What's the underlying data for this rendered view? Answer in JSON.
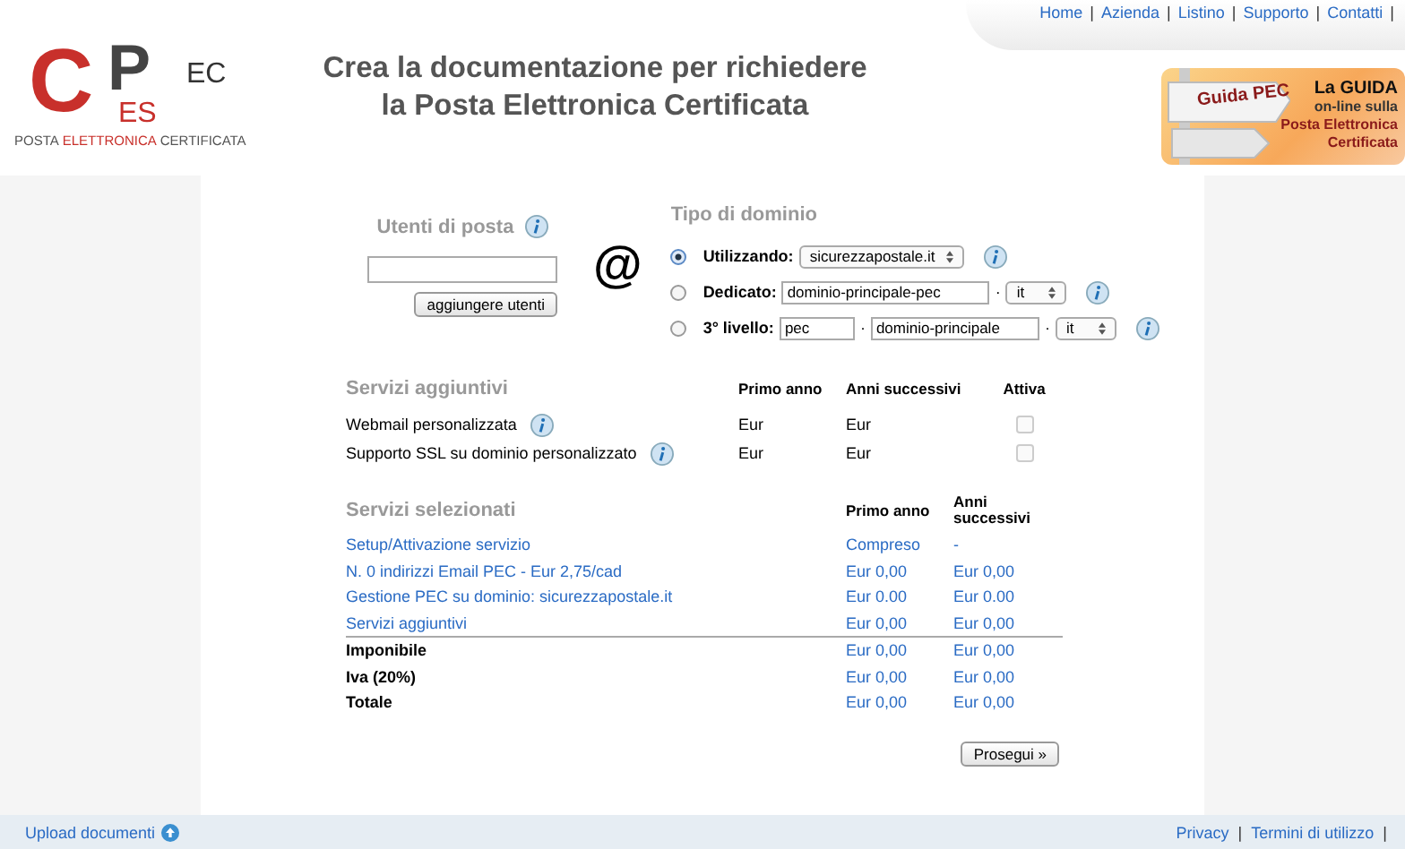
{
  "logo": {
    "big_c": "C",
    "big_p": "P",
    "es": "ES",
    "ec": "EC",
    "tagline": [
      "POSTA",
      "ELETTRONICA",
      "CERTIFICATA"
    ]
  },
  "headline": [
    "Crea la documentazione per richiedere",
    "la Posta Elettronica Certificata"
  ],
  "nav": [
    {
      "label": "Home",
      "sep": "|"
    },
    {
      "label": "Azienda",
      "sep": "|"
    },
    {
      "label": "Listino",
      "sep": "|"
    },
    {
      "label": "Supporto",
      "sep": "|"
    },
    {
      "label": "Contatti",
      "sep": "|"
    }
  ],
  "banner": {
    "sign": "Guida PEC",
    "line_1": "La GUIDA",
    "line_2": "on-line sulla",
    "line_3": "Posta Elettronica",
    "line_4": "Certificata"
  },
  "users": {
    "title": "Utenti di posta",
    "button": "aggiungere utenti",
    "at": "@"
  },
  "domain": {
    "title": "Tipo di dominio",
    "options": [
      {
        "label": "Utilizzando:",
        "selected": true,
        "fields": [
          {
            "kind": "select",
            "value": "sicurezzapostale.it"
          }
        ]
      },
      {
        "label": "Dedicato:",
        "selected": false,
        "fields": [
          {
            "kind": "input",
            "value": "dominio-principale-pec"
          },
          {
            "kind": "dot",
            "value": "·"
          },
          {
            "kind": "select",
            "value": "it"
          }
        ]
      },
      {
        "label": "3° livello:",
        "selected": false,
        "fields": [
          {
            "kind": "input",
            "value": "pec"
          },
          {
            "kind": "dot",
            "value": "·"
          },
          {
            "kind": "input",
            "value": "dominio-principale"
          },
          {
            "kind": "dot",
            "value": "·"
          },
          {
            "kind": "select",
            "value": "it"
          }
        ]
      }
    ]
  },
  "extras": {
    "title": "Servizi aggiuntivi",
    "columns": [
      "Primo anno",
      "Anni successivi",
      "Attiva"
    ],
    "rows": [
      {
        "label": "Webmail personalizzata",
        "first": "Eur",
        "next": "Eur",
        "checked": false
      },
      {
        "label": "Supporto SSL su dominio personalizzato",
        "first": "Eur",
        "next": "Eur",
        "checked": false
      }
    ]
  },
  "selected": {
    "title": "Servizi selezionati",
    "columns": [
      "Primo anno",
      "Anni successivi"
    ],
    "rows": [
      {
        "kind": "item",
        "label": "Setup/Attivazione servizio",
        "first": "Compreso",
        "next": "-"
      },
      {
        "kind": "item",
        "label": "N. 0 indirizzi Email PEC - Eur 2,75/cad",
        "first": "Eur 0,00",
        "next": "Eur 0,00"
      },
      {
        "kind": "item",
        "label": "Gestione PEC su dominio: sicurezzapostale.it",
        "first": "Eur 0.00",
        "next": "Eur 0.00"
      },
      {
        "kind": "item",
        "label": "Servizi aggiuntivi",
        "first": "Eur 0,00",
        "next": "Eur 0,00"
      },
      {
        "kind": "total",
        "label": "Imponibile",
        "first": "Eur 0,00",
        "next": "Eur 0,00"
      },
      {
        "kind": "total",
        "label": "Iva (20%)",
        "first": "Eur 0,00",
        "next": "Eur 0,00"
      },
      {
        "kind": "total",
        "label": "Totale",
        "first": "Eur 0,00",
        "next": "Eur 0,00"
      }
    ]
  },
  "continue_button": "Prosegui »",
  "footer": {
    "upload": "Upload documenti",
    "links": [
      {
        "label": "Privacy",
        "sep": "|"
      },
      {
        "label": "Termini di utilizzo",
        "sep": "|"
      }
    ]
  }
}
